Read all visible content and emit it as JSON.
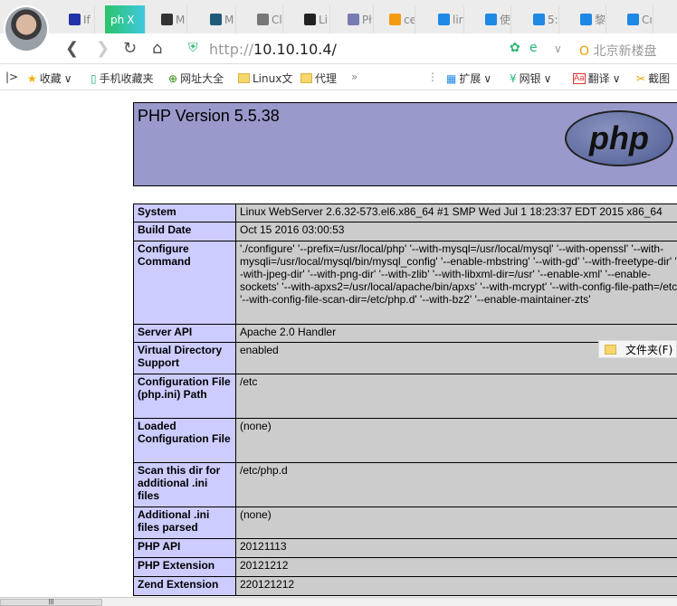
{
  "browser": {
    "tabs": [
      {
        "label": "If",
        "color": "#2233aa"
      },
      {
        "label": "ph",
        "color": "#2bc36a"
      },
      {
        "label": "M",
        "color": "#333333"
      },
      {
        "label": "M",
        "color": "#1e5a7a"
      },
      {
        "label": "Cl",
        "color": "#777777"
      },
      {
        "label": "Li",
        "color": "#222222"
      },
      {
        "label": "Pł",
        "color": "#777bb3"
      },
      {
        "label": "ce",
        "color": "#f39c12"
      },
      {
        "label": "lir",
        "color": "#1e88e5"
      },
      {
        "label": "使",
        "color": "#1e88e5"
      },
      {
        "label": "5:",
        "color": "#1e88e5"
      },
      {
        "label": "黎",
        "color": "#1e88e5"
      },
      {
        "label": "Cı",
        "color": "#1e88e5"
      }
    ],
    "active_tab_close": "X",
    "url_scheme": "http://",
    "url_host": "10.10.10.4/",
    "search_placeholder": "北京新楼盘",
    "bookmarks": [
      "收藏",
      "手机收藏夹",
      "网址大全",
      "Linux文",
      "代理"
    ],
    "more": "»",
    "tools": [
      "扩展",
      "网银",
      "翻译",
      "截图"
    ]
  },
  "page": {
    "title": "PHP Version 5.5.38",
    "logo": "php",
    "rows": [
      {
        "k": "System",
        "v": "Linux WebServer 2.6.32-573.el6.x86_64 #1 SMP Wed Jul 1 18:23:37 EDT 2015 x86_64"
      },
      {
        "k": "Build Date",
        "v": "Oct 15 2016 03:00:53"
      },
      {
        "k": "Configure Command",
        "v": "'./configure' '--prefix=/usr/local/php' '--with-mysql=/usr/local/mysql' '--with-openssl' '--with-mysqli=/usr/local/mysql/bin/mysql_config' '--enable-mbstring' '--with-gd' '--with-freetype-dir' '--with-jpeg-dir' '--with-png-dir' '--with-zlib' '--with-libxml-dir=/usr' '--enable-xml' '--enable-sockets' '--with-apxs2=/usr/local/apache/bin/apxs' '--with-mcrypt' '--with-config-file-path=/etc' '--with-config-file-scan-dir=/etc/php.d' '--with-bz2' '--enable-maintainer-zts'"
      },
      {
        "k": "Server API",
        "v": "Apache 2.0 Handler"
      },
      {
        "k": "Virtual Directory Support",
        "v": "enabled"
      },
      {
        "k": "Configuration File (php.ini) Path",
        "v": "/etc"
      },
      {
        "k": "Loaded Configuration File",
        "v": "(none)"
      },
      {
        "k": "Scan this dir for additional .ini files",
        "v": "/etc/php.d"
      },
      {
        "k": "Additional .ini files parsed",
        "v": "(none)"
      },
      {
        "k": "PHP API",
        "v": "20121113"
      },
      {
        "k": "PHP Extension",
        "v": "20121212"
      },
      {
        "k": "Zend Extension",
        "v": "220121212"
      }
    ]
  },
  "popup": {
    "label": "文件夹(F)"
  }
}
